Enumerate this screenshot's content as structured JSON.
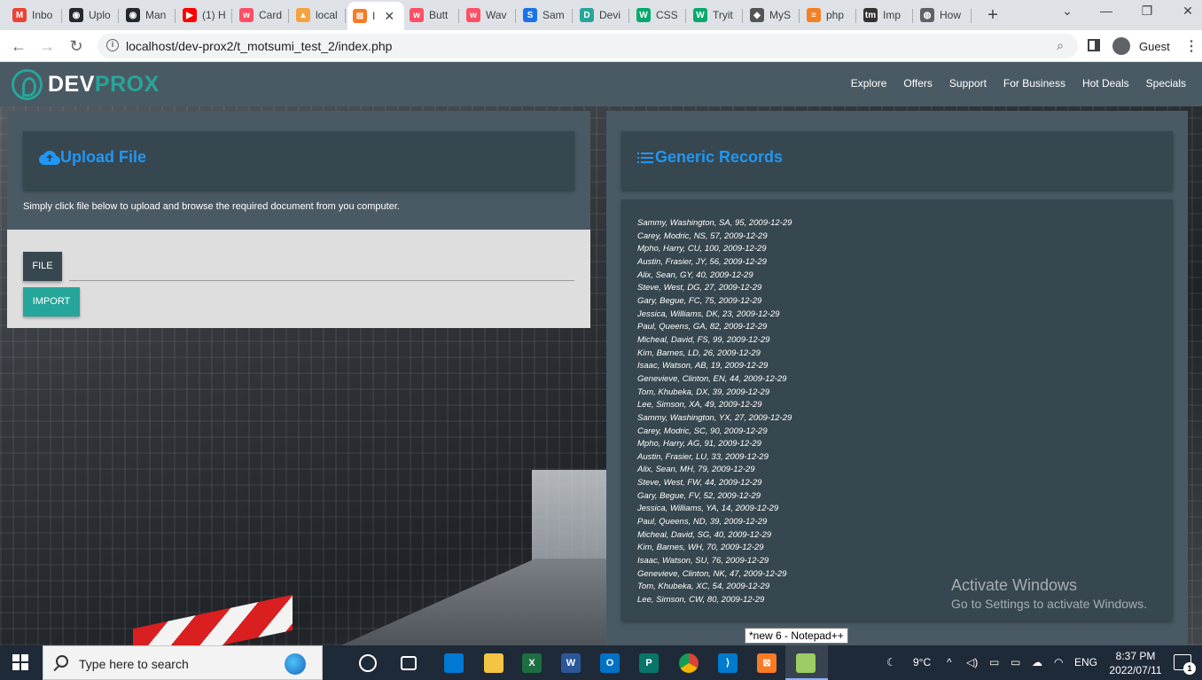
{
  "browser": {
    "tabs": [
      {
        "label": "Inbo",
        "icon": "gmail-icon",
        "color": "#ea4335",
        "glyph": "M"
      },
      {
        "label": "Uplo",
        "icon": "github-icon",
        "color": "#24292e",
        "glyph": "◉"
      },
      {
        "label": "Man",
        "icon": "github-icon",
        "color": "#24292e",
        "glyph": "◉"
      },
      {
        "label": "(1) H",
        "icon": "youtube-icon",
        "color": "#ff0000",
        "glyph": "▶"
      },
      {
        "label": "Card",
        "icon": "wave-icon",
        "color": "#ff4f64",
        "glyph": "w"
      },
      {
        "label": "local",
        "icon": "phpmyadmin-icon",
        "color": "#f4a340",
        "glyph": "▲"
      },
      {
        "label": "I",
        "icon": "xampp-icon",
        "color": "#fb7a24",
        "glyph": "⊠"
      },
      {
        "label": "Butt",
        "icon": "wave-icon",
        "color": "#ff4f64",
        "glyph": "w"
      },
      {
        "label": "Wav",
        "icon": "wave-icon",
        "color": "#ff4f64",
        "glyph": "w"
      },
      {
        "label": "Sam",
        "icon": "s-icon",
        "color": "#1a73e8",
        "glyph": "S"
      },
      {
        "label": "Devi",
        "icon": "devprox-icon",
        "color": "#26a69a",
        "glyph": "D"
      },
      {
        "label": "CSS",
        "icon": "w3schools-icon",
        "color": "#04aa6d",
        "glyph": "W"
      },
      {
        "label": "Tryit",
        "icon": "w3schools-icon",
        "color": "#04aa6d",
        "glyph": "W"
      },
      {
        "label": "MyS",
        "icon": "mysql-icon",
        "color": "#555555",
        "glyph": "◆"
      },
      {
        "label": "php",
        "icon": "stackoverflow-icon",
        "color": "#f48024",
        "glyph": "≡"
      },
      {
        "label": "Imp",
        "icon": "tm-icon",
        "color": "#333333",
        "glyph": "tm"
      },
      {
        "label": "How",
        "icon": "globe-icon",
        "color": "#5f6368",
        "glyph": "◍"
      }
    ],
    "url": "localhost/dev-prox2/t_motsumi_test_2/index.php",
    "guest_label": "Guest"
  },
  "site": {
    "logo_dev": "DEV",
    "logo_prox": "PROX",
    "menu": [
      "Explore",
      "Offers",
      "Support",
      "For Business",
      "Hot Deals",
      "Specials"
    ]
  },
  "upload": {
    "title": "Upload File",
    "hint": "Simply click file below to upload and browse the required document from you computer.",
    "file_label": "FILE",
    "file_value": "",
    "import_label": "IMPORT"
  },
  "records": {
    "title": "Generic Records",
    "items": [
      "Sammy, Washington, SA, 95, 2009-12-29",
      "Carey, Modric, NS, 57, 2009-12-29",
      "Mpho, Harry, CU, 100, 2009-12-29",
      "Austin, Frasier, JY, 56, 2009-12-29",
      "Alix, Sean, GY, 40, 2009-12-29",
      "Steve, West, DG, 27, 2009-12-29",
      "Gary, Begue, FC, 75, 2009-12-29",
      "Jessica, Williams, DK, 23, 2009-12-29",
      "Paul, Queens, GA, 82, 2009-12-29",
      "Micheal, David, FS, 99, 2009-12-29",
      "Kim, Barnes, LD, 26, 2009-12-29",
      "Isaac, Watson, AB, 19, 2009-12-29",
      "Genevieve, Clinton, EN, 44, 2009-12-29",
      "Tom, Khubeka, DX, 39, 2009-12-29",
      "Lee, Simson, XA, 49, 2009-12-29",
      "Sammy, Washington, YX, 27, 2009-12-29",
      "Carey, Modric, SC, 90, 2009-12-29",
      "Mpho, Harry, AG, 91, 2009-12-29",
      "Austin, Frasier, LU, 33, 2009-12-29",
      "Alix, Sean, MH, 79, 2009-12-29",
      "Steve, West, FW, 44, 2009-12-29",
      "Gary, Begue, FV, 52, 2009-12-29",
      "Jessica, Williams, YA, 14, 2009-12-29",
      "Paul, Queens, ND, 39, 2009-12-29",
      "Micheal, David, SG, 40, 2009-12-29",
      "Kim, Barnes, WH, 70, 2009-12-29",
      "Isaac, Watson, SU, 76, 2009-12-29",
      "Genevieve, Clinton, NK, 47, 2009-12-29",
      "Tom, Khubeka, XC, 54, 2009-12-29",
      "Lee, Simson, CW, 80, 2009-12-29"
    ]
  },
  "overlay": {
    "activate_title": "Activate Windows",
    "activate_sub": "Go to Settings to activate Windows.",
    "tooltip": "*new 6 - Notepad++"
  },
  "taskbar": {
    "search_placeholder": "Type here to search",
    "temperature": "9°C",
    "language": "ENG",
    "time": "8:37 PM",
    "date": "2022/07/11",
    "notifications": "1"
  },
  "colors": {
    "accent_blue": "#2196f3",
    "teal": "#26a69a",
    "panel": "#4a5a64",
    "panel_dark": "#37474f"
  }
}
